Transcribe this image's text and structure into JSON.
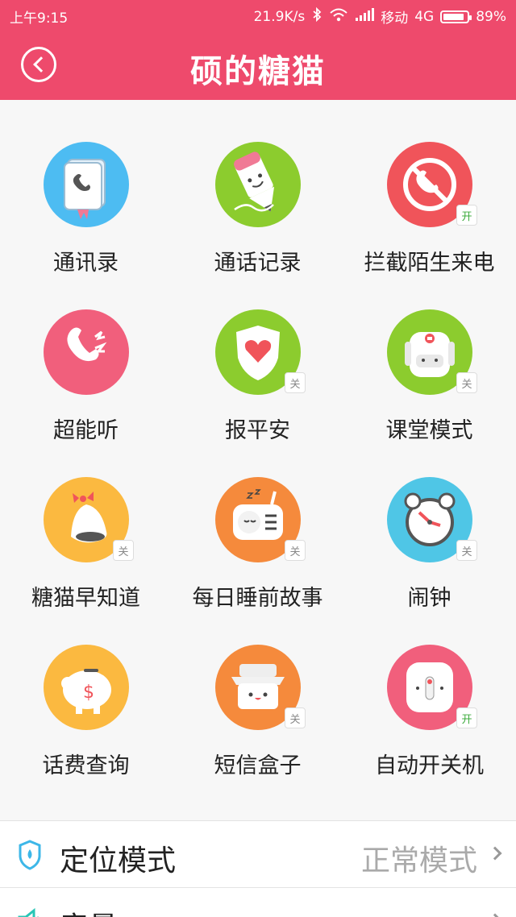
{
  "status_bar": {
    "time": "上午9:15",
    "speed": "21.9K/s",
    "carrier": "移动",
    "network": "4G",
    "battery": "89%",
    "battery_level": 0.89,
    "icons": [
      "bluetooth-icon",
      "wifi-icon",
      "signal-icon",
      "battery-icon"
    ]
  },
  "header": {
    "title": "硕的糖猫",
    "back_icon": "back-circle-icon"
  },
  "badge_labels": {
    "on": "开",
    "off": "关"
  },
  "features": [
    {
      "label": "通讯录",
      "icon": "phonebook-icon",
      "color": "#4dbcf2"
    },
    {
      "label": "通话记录",
      "icon": "pencil-icon",
      "color": "#8ccc2e"
    },
    {
      "label": "拦截陌生来电",
      "icon": "block-call-icon",
      "color": "#f0545a",
      "badge": "开"
    },
    {
      "label": "超能听",
      "icon": "phone-listen-icon",
      "color": "#f15f7c"
    },
    {
      "label": "报平安",
      "icon": "heart-shield-icon",
      "color": "#8ccc2e",
      "badge": "关"
    },
    {
      "label": "课堂模式",
      "icon": "backpack-icon",
      "color": "#8ccc2e",
      "badge": "关"
    },
    {
      "label": "糖猫早知道",
      "icon": "bell-icon",
      "color": "#fbb940",
      "badge": "关"
    },
    {
      "label": "每日睡前故事",
      "icon": "radio-icon",
      "color": "#f58a3c",
      "badge": "关"
    },
    {
      "label": "闹钟",
      "icon": "alarm-clock-icon",
      "color": "#4fc6e6",
      "badge": "关"
    },
    {
      "label": "话费查询",
      "icon": "piggy-bank-icon",
      "color": "#fbb940"
    },
    {
      "label": "短信盒子",
      "icon": "message-box-icon",
      "color": "#f58a3c",
      "badge": "关"
    },
    {
      "label": "自动开关机",
      "icon": "power-device-icon",
      "color": "#f15f7c",
      "badge": "开"
    }
  ],
  "settings": [
    {
      "label": "定位模式",
      "value": "正常模式",
      "icon": "location-mode-icon",
      "icon_color": "#3db7e8"
    },
    {
      "label": "音量",
      "value": "",
      "icon": "volume-icon",
      "icon_color": "#29c6b6"
    }
  ]
}
